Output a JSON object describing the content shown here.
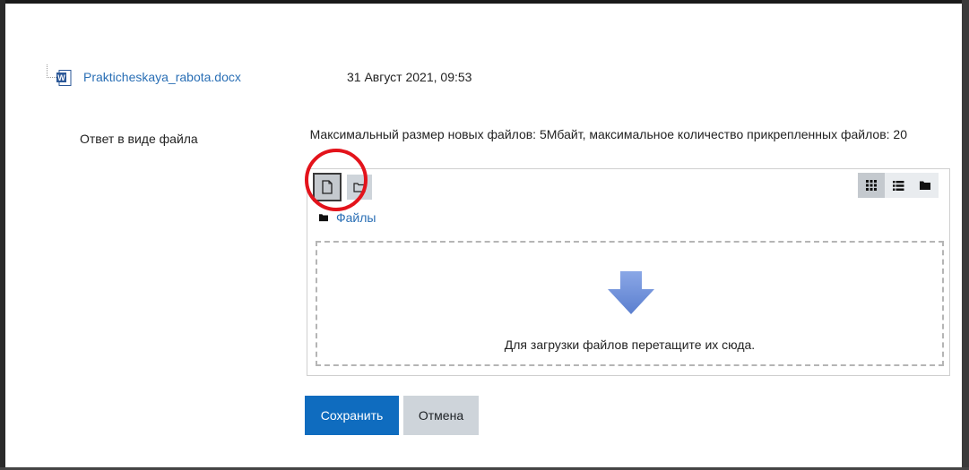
{
  "submission": {
    "file_name": "Prakticheskaya_rabota.docx",
    "file_date": "31 Август 2021, 09:53"
  },
  "file_field": {
    "label": "Ответ в виде файла",
    "limits_text": "Максимальный размер новых файлов: 5Мбайт, максимальное количество прикрепленных файлов: 20",
    "breadcrumb": "Файлы",
    "drop_text": "Для загрузки файлов перетащите их сюда."
  },
  "toolbar": {
    "add_icon": "file-icon",
    "create_folder_icon": "folder-outline-icon",
    "view_modes": [
      "grid-icon",
      "list-icon",
      "folder-icon"
    ]
  },
  "buttons": {
    "save_label": "Сохранить",
    "cancel_label": "Отмена"
  },
  "colors": {
    "link": "#2a6fb5",
    "primary": "#0f6cbf",
    "secondary": "#ced4da",
    "highlight": "#e3131b",
    "arrow": "#6d8fd6"
  }
}
